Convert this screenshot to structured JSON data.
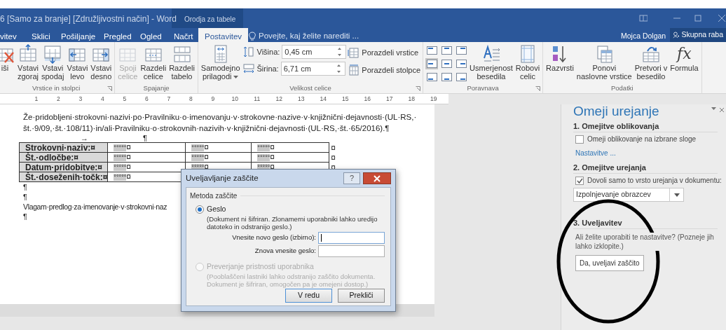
{
  "window": {
    "title": "6 [Samo za branje] [Združljivostni način] - Word",
    "context_group": "Orodja za tabele",
    "user": "Mojca Dolgan",
    "share_button": "Skupna raba"
  },
  "tabs": [
    {
      "label": "vitev",
      "selected": false
    },
    {
      "label": "Sklici",
      "selected": false
    },
    {
      "label": "Pošiljanje",
      "selected": false
    },
    {
      "label": "Pregled",
      "selected": false
    },
    {
      "label": "Ogled",
      "selected": false
    },
    {
      "label": "Načrt",
      "selected": false
    },
    {
      "label": "Postavitev",
      "selected": true
    }
  ],
  "tell_me": "Povejte, kaj želite narediti ...",
  "ribbon": {
    "groups": [
      {
        "label": "Vrstice in stolpci",
        "launcher": true,
        "items": [
          {
            "kind": "large",
            "label": "iši",
            "disabled": false
          },
          {
            "kind": "large",
            "label": "Vstavi\nzgoraj",
            "disabled": false
          },
          {
            "kind": "large",
            "label": "Vstavi\nspodaj",
            "disabled": false
          },
          {
            "kind": "large",
            "label": "Vstavi\nlevo",
            "disabled": false
          },
          {
            "kind": "large",
            "label": "Vstavi\ndesno",
            "disabled": false
          }
        ]
      },
      {
        "label": "Spajanje",
        "launcher": false,
        "items": [
          {
            "kind": "large",
            "label": "Spoji\ncelice",
            "disabled": true
          },
          {
            "kind": "large",
            "label": "Razdeli\ncelice",
            "disabled": false
          },
          {
            "kind": "large",
            "label": "Razdeli\ntabelo",
            "disabled": false
          }
        ]
      },
      {
        "label": "Velikost celice",
        "launcher": true,
        "items": [
          {
            "kind": "large",
            "label": "Samodejno\nprilagodi",
            "dropdown": true,
            "disabled": false
          },
          {
            "kind": "spins",
            "fields": [
              {
                "label": "Višina:",
                "value": "0,45 cm"
              },
              {
                "label": "Širina:",
                "value": "6,71 cm"
              }
            ]
          },
          {
            "kind": "smalls",
            "buttons": [
              {
                "label": "Porazdeli vrstice"
              },
              {
                "label": "Porazdeli stolpce"
              }
            ]
          }
        ]
      },
      {
        "label": "Poravnava",
        "launcher": true,
        "items": [
          {
            "kind": "align_grid",
            "cells": [
              {
                "selected": false
              },
              {
                "selected": false
              },
              {
                "selected": false
              },
              {
                "selected": true
              },
              {
                "selected": false
              },
              {
                "selected": false
              },
              {
                "selected": false
              },
              {
                "selected": false
              },
              {
                "selected": false
              }
            ]
          },
          {
            "kind": "large",
            "label": "Usmerjenost\nbesedila",
            "disabled": false
          },
          {
            "kind": "large",
            "label": "Robovi\ncelic",
            "disabled": false
          }
        ]
      },
      {
        "label": "Podatki",
        "launcher": false,
        "items": [
          {
            "kind": "large",
            "label": "Razvrsti",
            "disabled": false
          },
          {
            "kind": "large",
            "label": "Ponovi\nnaslovne vrstice",
            "disabled": false
          },
          {
            "kind": "large",
            "label": "Pretvori v\nbesedilo",
            "disabled": false
          },
          {
            "kind": "large",
            "glyph": "fx",
            "label": "Formula",
            "disabled": false
          }
        ]
      }
    ]
  },
  "ruler": {
    "numbers": [
      "1",
      "2",
      "3",
      "4",
      "5",
      "6",
      "7",
      "8",
      "9",
      "10",
      "11",
      "12",
      "13",
      "14",
      "15",
      "16",
      "17",
      "18",
      "19"
    ]
  },
  "document": {
    "paragraph": "Že·pridobljeni·strokovni·nazivi·po·Pravilniku·o·imenovanju·v·strokovne·nazive·v·knjižnični·dejavnosti·(UL·RS,·št.·9/09,·št.·108/11)·in/ali·Pravilniku·o·strokovnih·nazivih·v·knjižnični·dejavnosti·(UL·RS,·št.·65/2016).¶",
    "marks_line": [
      "→",
      "¶"
    ],
    "table": {
      "rows": [
        {
          "label": "Strokovni·naziv:¤",
          "cells": [
            {
              "field": "°°°°°",
              "mark": "¤"
            },
            {
              "field": "°°°°°",
              "mark": "¤"
            },
            {
              "field": "°°°°°",
              "mark": "¤"
            }
          ],
          "end_mark": "¤"
        },
        {
          "label": "Št.·odločbe:¤",
          "cells": [
            {
              "field": "°°°°°",
              "mark": "¤"
            },
            {
              "field": "°°°°°",
              "mark": "¤"
            },
            {
              "field": "°°°°°",
              "mark": "¤"
            }
          ],
          "end_mark": "¤"
        },
        {
          "label": "Datum·pridobitve:¤",
          "cells": [
            {
              "field": "°°°°°",
              "mark": "¤"
            },
            {
              "field": "°°°°°",
              "mark": "¤"
            },
            {
              "field": "°°°°°",
              "mark": "¤"
            }
          ],
          "end_mark": "¤"
        },
        {
          "label": "Št.·doseženih·točk:¤",
          "cells": [
            {
              "field": "°°°°°",
              "mark": "¤"
            }
          ]
        }
      ]
    },
    "after_table": [
      "¶",
      "¶",
      "Vlagam·predlog·za·imenovanje·v·strokovni·naz",
      "¶"
    ]
  },
  "dialog": {
    "title": "Uveljavljanje zaščite",
    "help": "?",
    "group_label": "Metoda zaščite",
    "options": [
      {
        "label": "Geslo",
        "selected": true,
        "disabled": false,
        "description": "(Dokument ni šifriran. Zlonamerni uporabniki lahko uredijo datoteko in odstranijo geslo.)",
        "fields": [
          {
            "label": "Vnesite novo geslo (izbirno):",
            "focused": true
          },
          {
            "label": "Znova vnesite geslo:",
            "focused": false
          }
        ]
      },
      {
        "label": "Preverjanje pristnosti uporabnika",
        "selected": false,
        "disabled": true,
        "description": "(Pooblaščeni lastniki lahko odstranijo zaščito dokumenta. Dokument je šifriran, omogočen pa je omejeni dostop.)"
      }
    ],
    "buttons": [
      {
        "label": "V redu",
        "default": true
      },
      {
        "label": "Prekliči",
        "default": false
      }
    ]
  },
  "task_pane": {
    "title": "Omeji urejanje",
    "formatting": {
      "heading": "1. Omejitve oblikovanja",
      "checkbox": {
        "label": "Omeji oblikovanje na izbrane sloge",
        "checked": false
      },
      "link": "Nastavitve ..."
    },
    "editing": {
      "heading": "2. Omejitve urejanja",
      "checkbox": {
        "label": "Dovoli samo to vrsto urejanja v dokumentu:",
        "checked": true
      },
      "dropdown": "Izpolnjevanje obrazcev"
    },
    "enforcement": {
      "heading": "3. Uveljavitev",
      "text": "Ali želite uporabiti te nastavitve? (Pozneje jih lahko izklopite.)",
      "button": "Da, uveljavi zaščito"
    }
  }
}
